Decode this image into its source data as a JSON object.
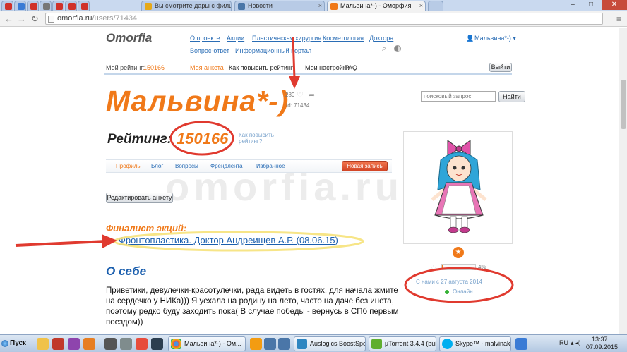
{
  "browser": {
    "tabs": [
      {
        "label": "",
        "color": "#d0322a"
      },
      {
        "label": "",
        "color": "#3a7bd5"
      },
      {
        "label": "",
        "color": "#d0322a"
      },
      {
        "label": "",
        "color": "#777777"
      },
      {
        "label": "",
        "color": "#d0322a"
      },
      {
        "label": "",
        "color": "#d0322a"
      },
      {
        "label": "",
        "color": "#d0322a"
      },
      {
        "label": "Вы смотрите дары с филь",
        "color": "#e6a817"
      },
      {
        "label": "Новости",
        "color": "#4a76a8"
      },
      {
        "label": "Мальвина*-) - Оморфия",
        "color": "#f07919"
      }
    ],
    "url_domain": "omorfia.ru",
    "url_path": "/users/71434"
  },
  "site": {
    "logo": "Omorfia",
    "nav": [
      "О проекте",
      "Акции",
      "Пластическая хирургия",
      "Косметология",
      "Доктора",
      "Вопрос-ответ",
      "Информационный портал"
    ],
    "user_menu": "Мальвина*-) ▾",
    "infobar": {
      "rating_label": "Мой рейтинг:",
      "rating_value": "150166",
      "links": [
        "Моя анкета",
        "Как повысить рейтинг",
        "Мои настройки",
        "FAQ"
      ],
      "logout": "Выйти"
    },
    "search": {
      "placeholder": "поисковый запрос",
      "button": "Найти"
    }
  },
  "profile": {
    "name": "Мальвина*-)",
    "likes": "289",
    "id": "Id: 71434",
    "rating_label": "Рейтинг:",
    "rating_value": "150166",
    "rating_link": "Как повысить рейтинг?",
    "tabs": [
      "Профиль",
      "Блог",
      "Вопросы",
      "Френдлента",
      "Избранное"
    ],
    "new_post": "Новая запись",
    "edit_button": "Редактировать анкету",
    "finalist_title": "Финалист акций:",
    "finalist_link": "Фронтопластика. Доктор Андреищев А.Р. (08.06.15)",
    "about_title": "О себе",
    "about_text": "Приветики, девулечки-красотулечки, рада видеть в гостях, для начала жмите на сердечко у НИКа))) Я уехала на родину на лето, часто на даче без инета, поэтому редко буду заходить пока( В случае победы - вернусь в СПб первым поездом))",
    "progress_pct": "4%",
    "progress_value": 0.04,
    "member_since": "С нами с 27 августа 2014",
    "online": "Онлайн"
  },
  "watermark": "omorfia.ru",
  "taskbar": {
    "start": "Пуск",
    "tasks": [
      "Мальвина*-) - Ом...",
      "Auslogics BoostSpeed",
      "µTorrent 3.4.4 (build...",
      "Skype™ - malvinakyk"
    ],
    "lang": "RU",
    "time": "13:37",
    "date": "07.09.2015"
  },
  "colors": {
    "accent": "#f07919",
    "link": "#2a6db5",
    "annotation": "#e03a2f"
  }
}
